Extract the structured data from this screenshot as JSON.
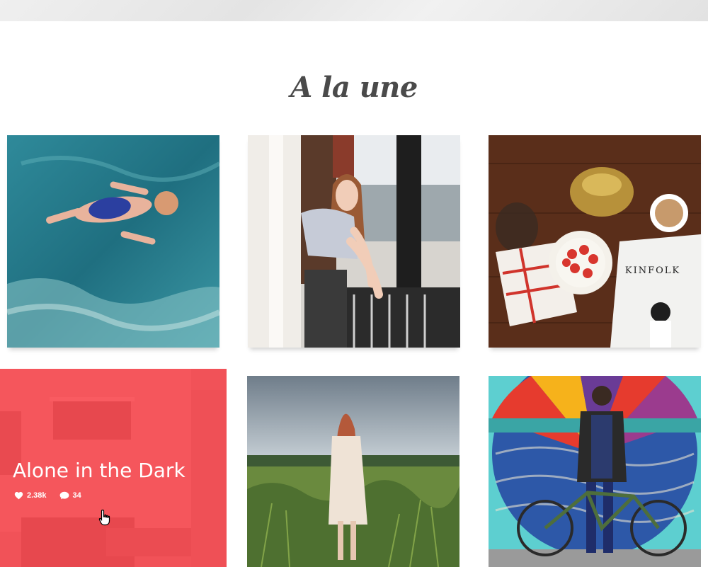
{
  "section": {
    "title": "A la une"
  },
  "gallery": {
    "items": [
      {
        "name": "swimmer-photo"
      },
      {
        "name": "woman-at-window-photo"
      },
      {
        "name": "breakfast-table-photo"
      },
      {
        "name": "alone-in-the-dark-photo",
        "hover": true,
        "title": "Alone in the Dark",
        "likes": "2.38k",
        "comments": "34",
        "overlay_color": "#fa4850"
      },
      {
        "name": "woman-in-field-photo"
      },
      {
        "name": "woman-with-bicycle-photo"
      }
    ]
  },
  "magazine_label": "KINFOLK",
  "icons": {
    "likes": "heart-icon",
    "comments": "speech-bubble-icon",
    "cursor": "hand-cursor-icon"
  }
}
